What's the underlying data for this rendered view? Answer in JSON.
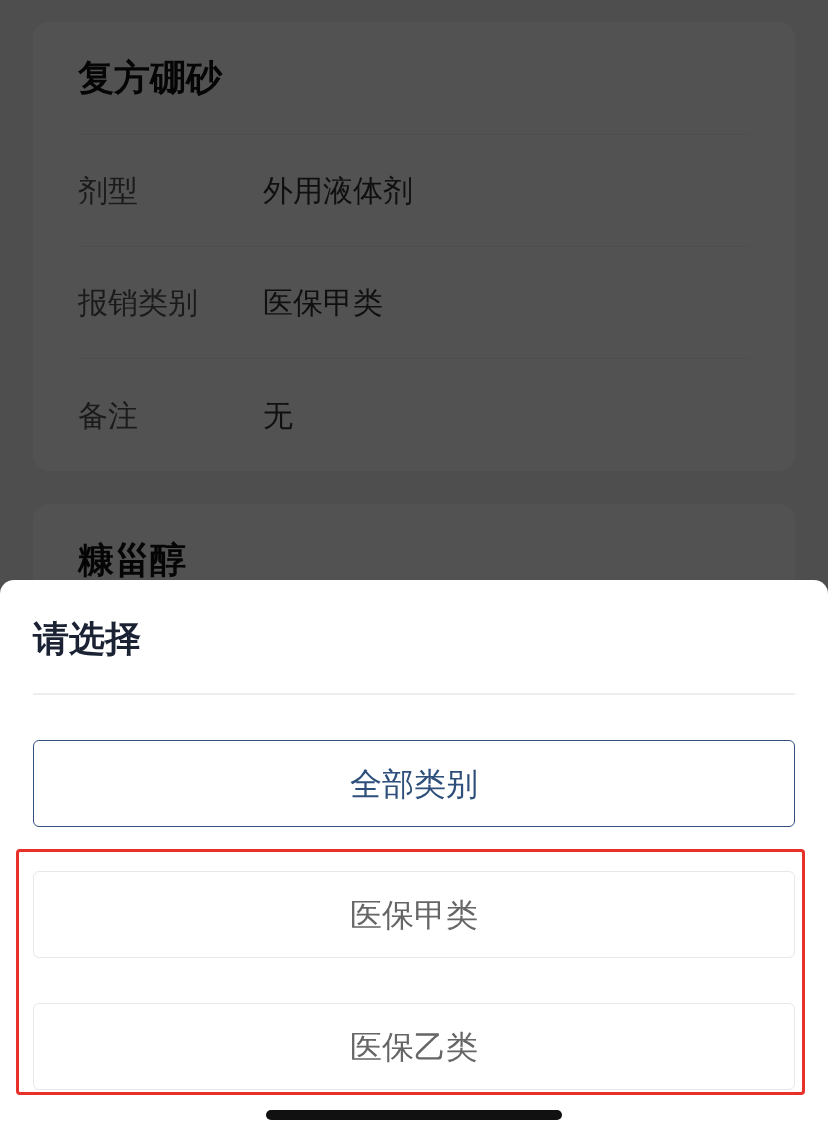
{
  "details": [
    {
      "title": "复方硼砂",
      "fields": [
        {
          "label": "剂型",
          "value": "外用液体剂"
        },
        {
          "label": "报销类别",
          "value": "医保甲类"
        },
        {
          "label": "备注",
          "value": "无"
        }
      ]
    },
    {
      "title": "糠甾醇"
    }
  ],
  "sheet": {
    "title": "请选择",
    "options": [
      {
        "label": "全部类别",
        "selected": true,
        "highlighted": false
      },
      {
        "label": "医保甲类",
        "selected": false,
        "highlighted": true
      },
      {
        "label": "医保乙类",
        "selected": false,
        "highlighted": true
      }
    ]
  }
}
